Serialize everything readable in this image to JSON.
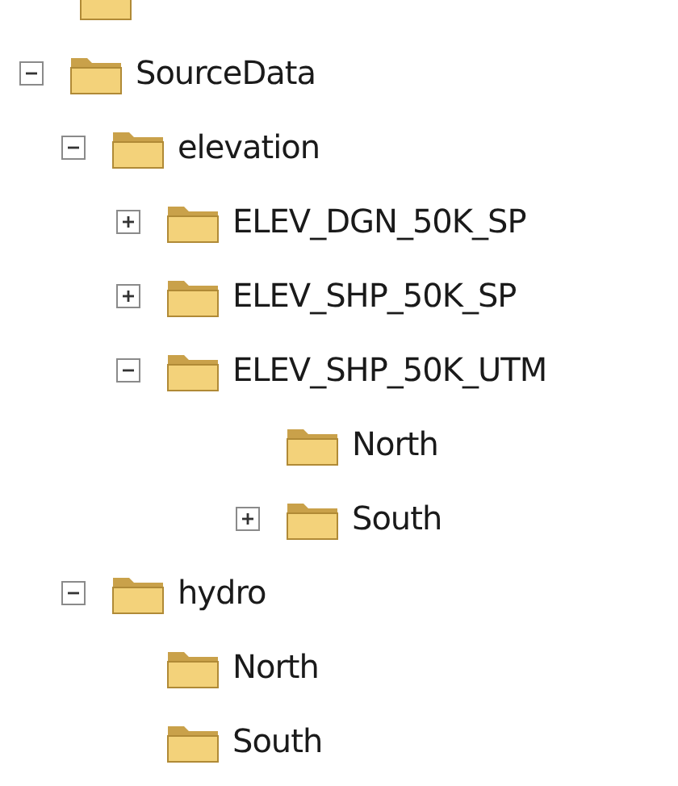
{
  "tree": [
    {
      "label": "SourceData",
      "expanded": true,
      "children": [
        {
          "label": "elevation",
          "expanded": true,
          "children": [
            {
              "label": "ELEV_DGN_50K_SP",
              "expanded": false
            },
            {
              "label": "ELEV_SHP_50K_SP",
              "expanded": false
            },
            {
              "label": "ELEV_SHP_50K_UTM",
              "expanded": true,
              "children": [
                {
                  "label": "North"
                },
                {
                  "label": "South",
                  "expanded": false
                }
              ]
            }
          ]
        },
        {
          "label": "hydro",
          "expanded": true,
          "children": [
            {
              "label": "North"
            },
            {
              "label": "South"
            }
          ]
        }
      ]
    }
  ]
}
